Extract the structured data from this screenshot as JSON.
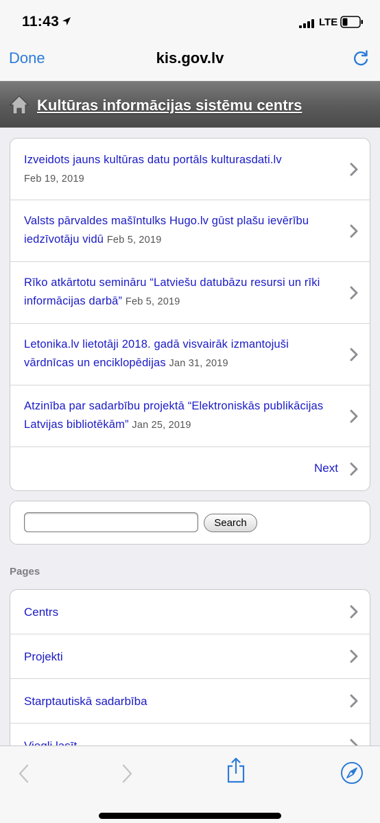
{
  "status_bar": {
    "time": "11:43",
    "network": "LTE"
  },
  "browser": {
    "done_label": "Done",
    "url": "kis.gov.lv",
    "icons": [
      "reload-icon",
      "back-icon",
      "forward-icon",
      "share-icon",
      "safari-compass-icon"
    ]
  },
  "site": {
    "title": "Kultūras informācijas sistēmu centrs"
  },
  "news": {
    "items": [
      {
        "title": "Izveidots jauns kultūras datu portāls kulturasdati.lv",
        "date": "Feb 19, 2019"
      },
      {
        "title": "Valsts pārvaldes mašīntulks Hugo.lv gūst plašu ievērību iedzīvotāju vidū",
        "date": "Feb 5, 2019"
      },
      {
        "title": "Rīko atkārtotu semināru “Latviešu datubāzu resursi un rīki informācijas darbā”",
        "date": "Feb 5, 2019"
      },
      {
        "title": "Letonika.lv lietotāji 2018. gadā visvairāk izmantojuši vārdnīcas un enciklopēdijas",
        "date": "Jan 31, 2019"
      },
      {
        "title": "Atzinība par sadarbību projektā “Elektroniskās publikācijas Latvijas bibliotēkām”",
        "date": "Jan 25, 2019"
      }
    ],
    "next_label": "Next"
  },
  "search": {
    "value": "",
    "button_label": "Search"
  },
  "pages": {
    "heading": "Pages",
    "items": [
      {
        "label": "Centrs"
      },
      {
        "label": "Projekti"
      },
      {
        "label": "Starptautiskā sadarbība"
      },
      {
        "label": "Viegli lasīt"
      }
    ]
  },
  "colors": {
    "link": "#1a1ac6",
    "ios_blue": "#2d7bd8",
    "header_gray": "#5c5c5c",
    "page_bg": "#efeff3"
  }
}
